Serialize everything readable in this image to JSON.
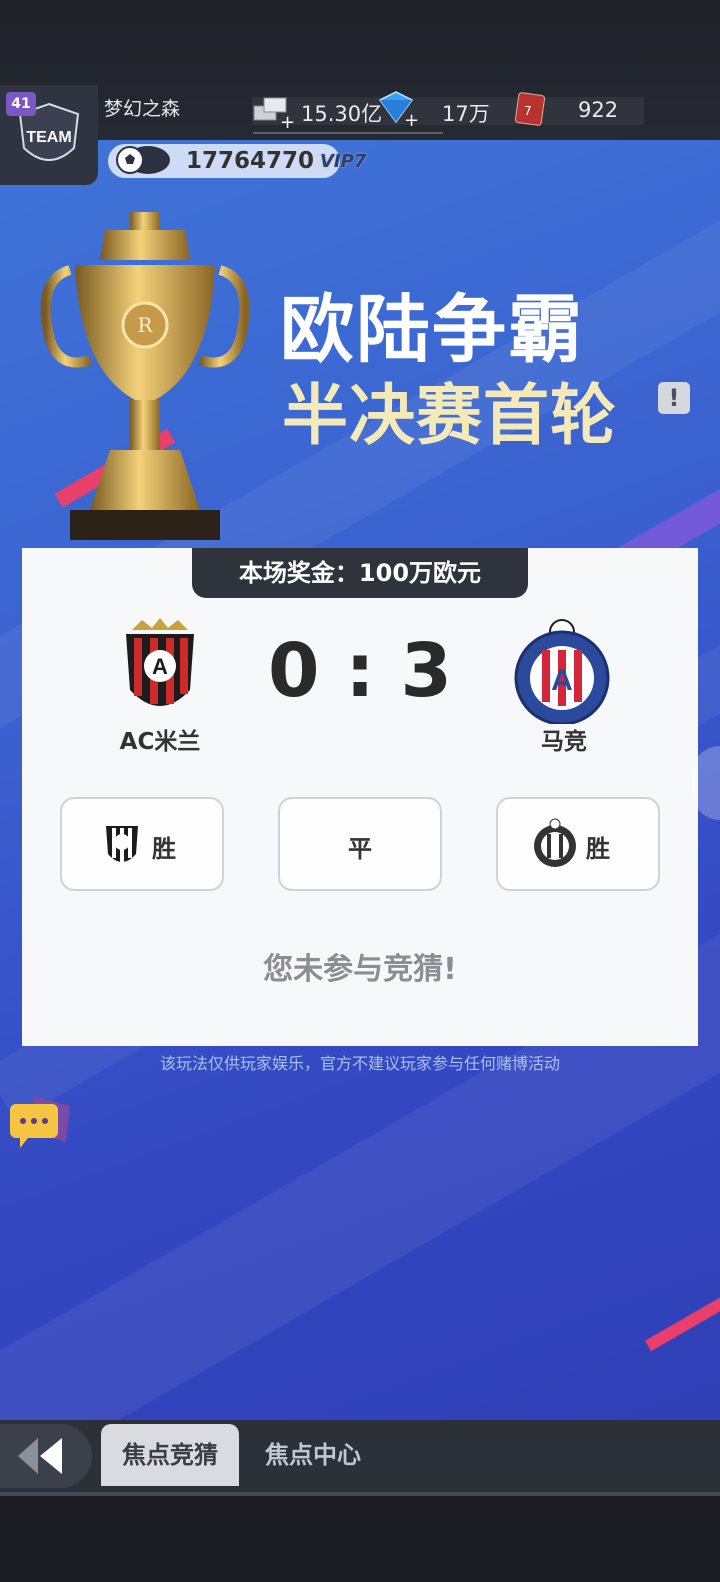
{
  "header": {
    "level": "41",
    "player_name": "梦幻之森",
    "coins": "17764770",
    "vip": "VIP7",
    "resources": [
      {
        "icon": "silver-bars-icon",
        "value": "15.30亿"
      },
      {
        "icon": "diamond-icon",
        "value": "17万"
      },
      {
        "icon": "card-icon",
        "value": "922"
      }
    ],
    "team_logo_text": "TEAM"
  },
  "event": {
    "title": "欧陆争霸",
    "subtitle": "半决赛首轮",
    "info_icon": "!"
  },
  "match": {
    "prize": "本场奖金：100万欧元",
    "home_team": "AC米兰",
    "away_team": "马竞",
    "score": "0 : 3",
    "bet_options": {
      "home_win": "胜",
      "draw": "平",
      "away_win": "胜"
    },
    "status": "您未参与竞猜!",
    "disclaimer": "该玩法仅供玩家娱乐，官方不建议玩家参与任何赌博活动"
  },
  "tabs": [
    {
      "label": "焦点竞猜",
      "active": true
    },
    {
      "label": "焦点中心",
      "active": false
    }
  ],
  "colors": {
    "background_blue": "#3a5fcf",
    "title_gold": "#f4eab8",
    "card_bg": "#f7f8fa",
    "prize_tab": "#2f333c"
  }
}
